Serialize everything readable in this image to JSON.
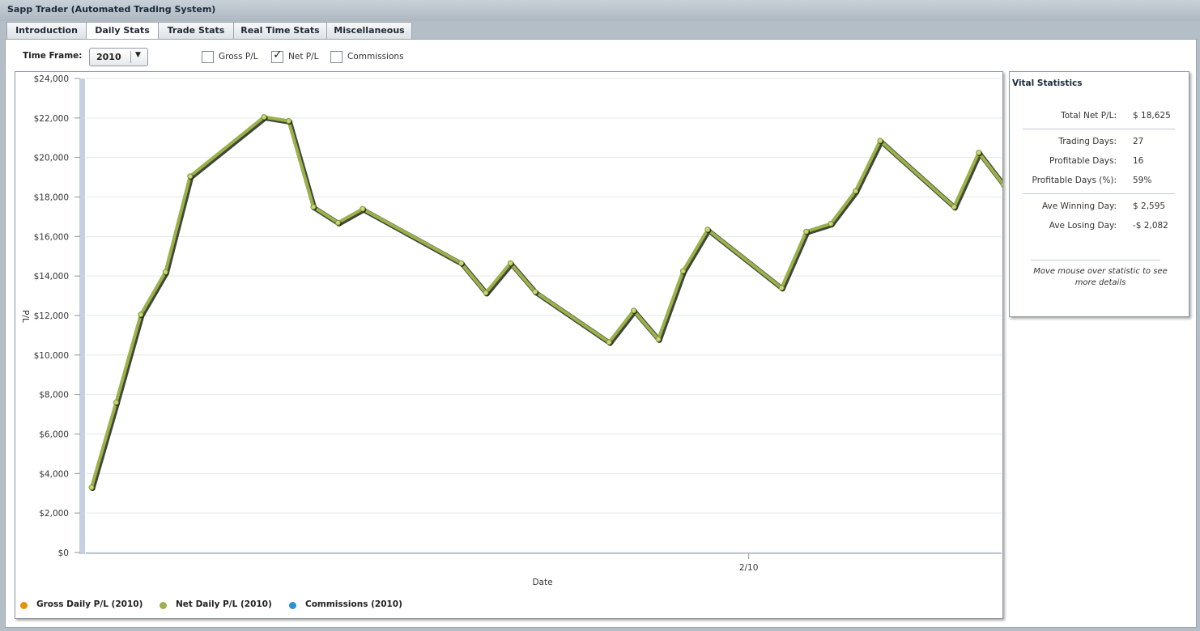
{
  "window": {
    "title": "Sapp Trader (Automated Trading System)"
  },
  "tabs": [
    {
      "label": "Introduction",
      "active": false
    },
    {
      "label": "Daily Stats",
      "active": true
    },
    {
      "label": "Trade Stats",
      "active": false
    },
    {
      "label": "Real Time Stats",
      "active": false
    },
    {
      "label": "Miscellaneous",
      "active": false
    }
  ],
  "controls": {
    "timeframe_label": "Time Frame:",
    "timeframe_value": "2010",
    "checkboxes": [
      {
        "label": "Gross P/L",
        "checked": false
      },
      {
        "label": "Net P/L",
        "checked": true
      },
      {
        "label": "Commissions",
        "checked": false
      }
    ]
  },
  "chart_data": {
    "type": "line",
    "title": "",
    "xlabel": "Date",
    "ylabel": "P/L",
    "ylim": [
      0,
      24000
    ],
    "ytick_values": [
      0,
      2000,
      4000,
      6000,
      8000,
      10000,
      12000,
      14000,
      16000,
      18000,
      20000,
      22000,
      24000
    ],
    "y_ticks": [
      "$0",
      "$2,000",
      "$4,000",
      "$6,000",
      "$8,000",
      "$10,000",
      "$12,000",
      "$14,000",
      "$16,000",
      "$18,000",
      "$20,000",
      "$22,000",
      "$24,000"
    ],
    "x_range_days": [
      1,
      56
    ],
    "x_ticks": [
      {
        "day": 41,
        "label": "2/10"
      }
    ],
    "grid": true,
    "legend_placement": "bottom-left",
    "series": [
      {
        "name": "Net Daily P/L (2010)",
        "color": "#9bb24a",
        "points": [
          {
            "day": 1,
            "value": 3300
          },
          {
            "day": 2.5,
            "value": 7600
          },
          {
            "day": 4,
            "value": 12050
          },
          {
            "day": 5.5,
            "value": 14200
          },
          {
            "day": 7,
            "value": 19050
          },
          {
            "day": 11.5,
            "value": 22050
          },
          {
            "day": 13,
            "value": 21850
          },
          {
            "day": 14.5,
            "value": 17500
          },
          {
            "day": 16,
            "value": 16700
          },
          {
            "day": 17.5,
            "value": 17400
          },
          {
            "day": 23.5,
            "value": 14650
          },
          {
            "day": 25,
            "value": 13150
          },
          {
            "day": 26.5,
            "value": 14650
          },
          {
            "day": 28,
            "value": 13200
          },
          {
            "day": 32.5,
            "value": 10650
          },
          {
            "day": 34,
            "value": 12250
          },
          {
            "day": 35.5,
            "value": 10800
          },
          {
            "day": 37,
            "value": 14250
          },
          {
            "day": 38.5,
            "value": 16350
          },
          {
            "day": 43,
            "value": 13400
          },
          {
            "day": 44.5,
            "value": 16250
          },
          {
            "day": 46,
            "value": 16650
          },
          {
            "day": 47.5,
            "value": 18300
          },
          {
            "day": 49,
            "value": 20850
          },
          {
            "day": 53.5,
            "value": 17500
          },
          {
            "day": 55,
            "value": 20250
          },
          {
            "day": 56.5,
            "value": 18625
          }
        ]
      }
    ]
  },
  "legend": [
    {
      "label": "Gross Daily P/L (2010)",
      "color": "#e8900c"
    },
    {
      "label": "Net Daily P/L (2010)",
      "color": "#9bb24a"
    },
    {
      "label": "Commissions (2010)",
      "color": "#2a93d4"
    }
  ],
  "vital": {
    "title": "Vital Statistics",
    "rows": [
      {
        "label": "Total Net P/L:",
        "value": "$ 18,625"
      },
      {
        "label": "Trading Days:",
        "value": "27"
      },
      {
        "label": "Profitable Days:",
        "value": "16"
      },
      {
        "label": "Profitable Days (%):",
        "value": "59%"
      },
      {
        "label": "Ave Winning Day:",
        "value": "$ 2,595"
      },
      {
        "label": "Ave Losing Day:",
        "value": "-$ 2,082"
      }
    ],
    "hint": "Move mouse over statistic to see more details"
  }
}
